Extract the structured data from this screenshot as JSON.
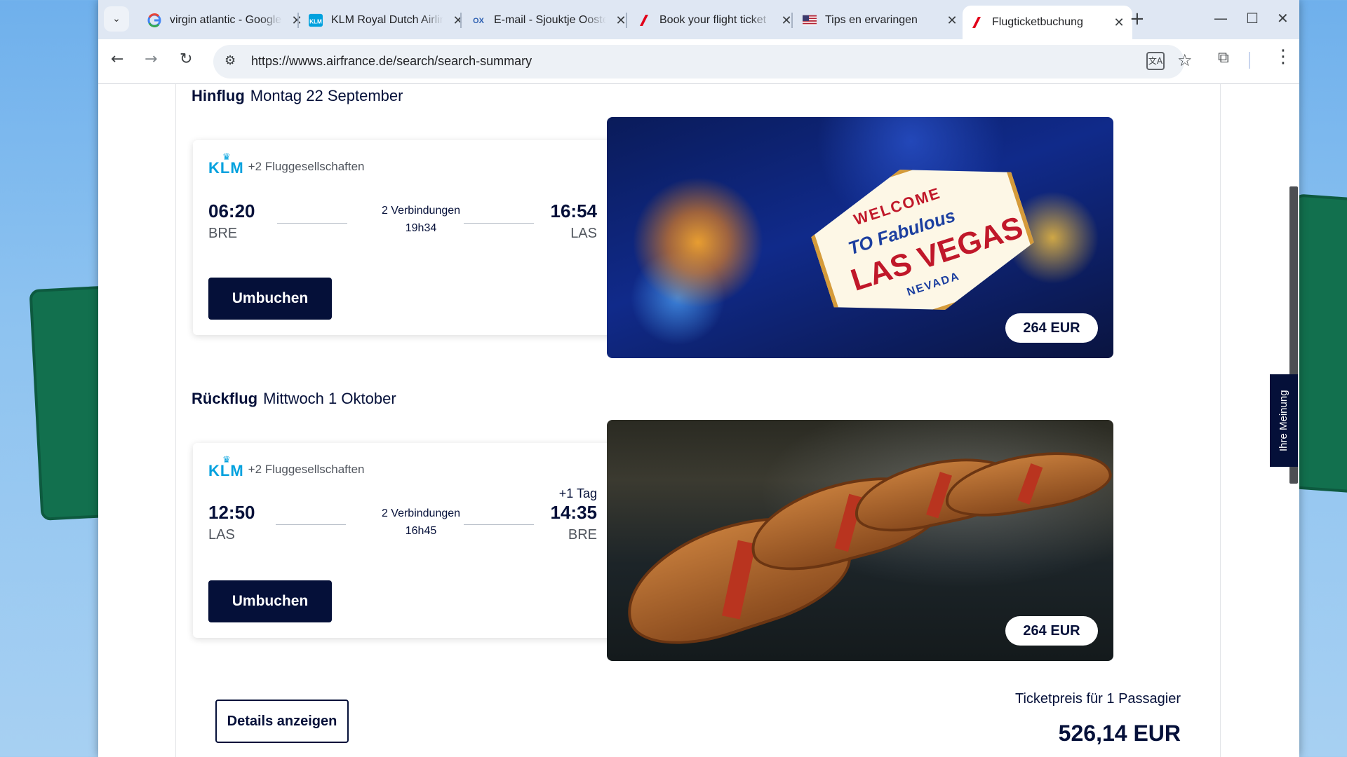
{
  "browser": {
    "tabs": [
      {
        "title": "virgin atlantic - Google",
        "favicon": "google-icon"
      },
      {
        "title": "KLM Royal Dutch Airlines",
        "favicon": "klm-icon"
      },
      {
        "title": "E-mail - Sjouktje Oosterhof",
        "favicon": "ox-mail-icon"
      },
      {
        "title": "Book your flight ticket",
        "favicon": "air-france-icon"
      },
      {
        "title": "Tips en ervaringen",
        "favicon": "us-flag-icon"
      },
      {
        "title": "Flugticketbuchung",
        "favicon": "air-france-icon",
        "active": true
      }
    ],
    "url": "https://wwws.airfrance.de/search/search-summary"
  },
  "outbound": {
    "label": "Hinflug",
    "date": "Montag 22 September",
    "airline": "KLM",
    "airline_extra": "+2 Fluggesellschaften",
    "dep_time": "06:20",
    "dep_code": "BRE",
    "connections": "2 Verbindungen",
    "duration": "19h34",
    "arr_time": "16:54",
    "arr_code": "LAS",
    "rebook_label": "Umbuchen",
    "price": "264 EUR",
    "image": "las-vegas-sign"
  },
  "return": {
    "label": "Rückflug",
    "date": "Mittwoch 1 Oktober",
    "airline": "KLM",
    "airline_extra": "+2 Fluggesellschaften",
    "dep_time": "12:50",
    "dep_code": "LAS",
    "connections": "2 Verbindungen",
    "duration": "16h45",
    "plus_day": "+1 Tag",
    "arr_time": "14:35",
    "arr_code": "BRE",
    "rebook_label": "Umbuchen",
    "price": "264 EUR",
    "image": "rowing-boats"
  },
  "footer": {
    "details_label": "Details anzeigen",
    "ticket_label": "Ticketpreis für 1 Passagier",
    "total": "526,14 EUR"
  },
  "feedback": {
    "label": "Ihre Meinung"
  },
  "vegas_sign": {
    "line1": "WELCOME",
    "line2": "TO Fabulous",
    "line3": "LAS VEGAS",
    "line4": "NEVADA"
  }
}
